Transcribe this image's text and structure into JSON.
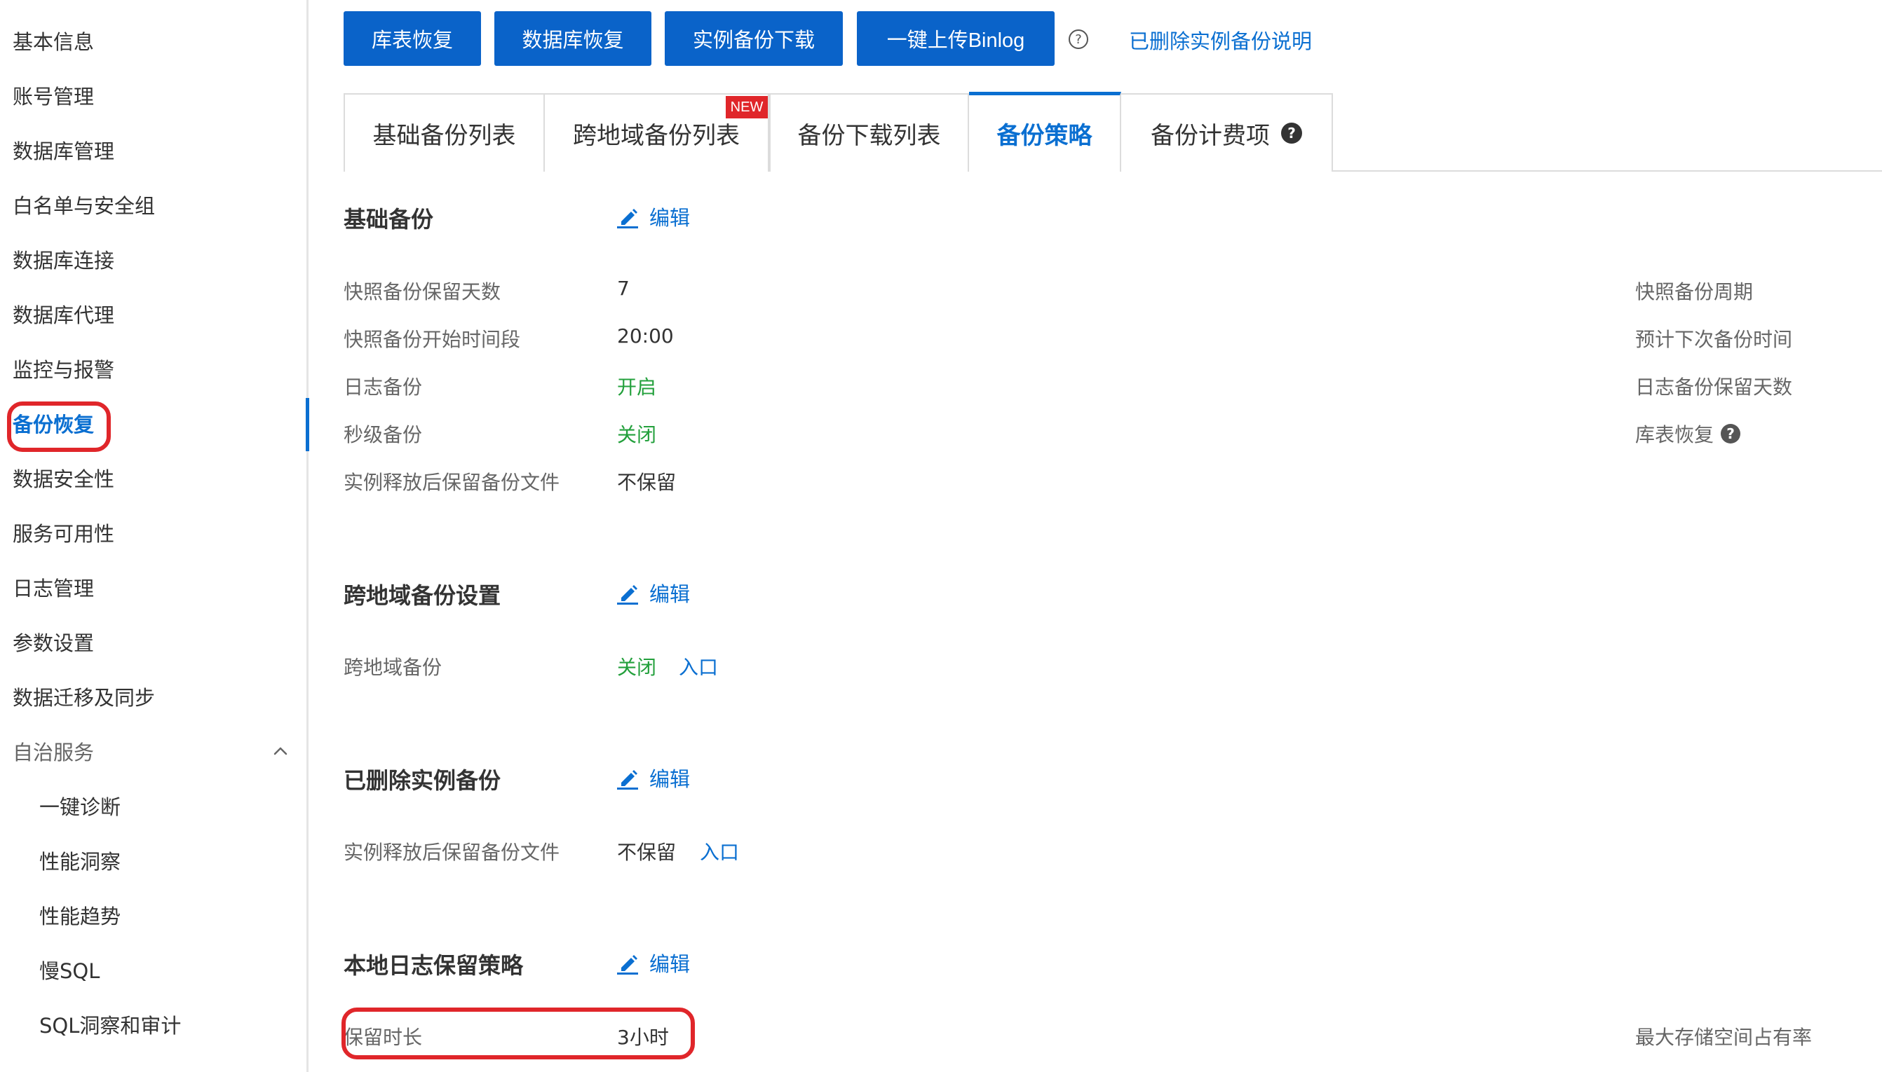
{
  "sidebar": {
    "items": [
      {
        "label": "基本信息"
      },
      {
        "label": "账号管理"
      },
      {
        "label": "数据库管理"
      },
      {
        "label": "白名单与安全组"
      },
      {
        "label": "数据库连接"
      },
      {
        "label": "数据库代理"
      },
      {
        "label": "监控与报警"
      },
      {
        "label": "备份恢复",
        "active": true
      },
      {
        "label": "数据安全性"
      },
      {
        "label": "服务可用性"
      },
      {
        "label": "日志管理"
      },
      {
        "label": "参数设置"
      },
      {
        "label": "数据迁移及同步"
      }
    ],
    "group": {
      "label": "自治服务",
      "expanded": true
    },
    "subitems": [
      {
        "label": "一键诊断"
      },
      {
        "label": "性能洞察"
      },
      {
        "label": "性能趋势"
      },
      {
        "label": "慢SQL"
      },
      {
        "label": "SQL洞察和审计"
      }
    ]
  },
  "toolbar": {
    "buttons": [
      {
        "label": "库表恢复"
      },
      {
        "label": "数据库恢复"
      },
      {
        "label": "实例备份下载"
      },
      {
        "label": "一键上传Binlog"
      }
    ],
    "help_icon": "question-circle-icon",
    "link": "已删除实例备份说明"
  },
  "tabs": {
    "items": [
      {
        "label": "基础备份列表"
      },
      {
        "label": "跨地域备份列表",
        "badge": "NEW"
      },
      {
        "label": "备份下载列表"
      },
      {
        "label": "备份策略",
        "active": true
      },
      {
        "label": "备份计费项",
        "help": true
      }
    ]
  },
  "sections": {
    "basic": {
      "title": "基础备份",
      "edit": "编辑",
      "rows": [
        {
          "label": "快照备份保留天数",
          "value": "7"
        },
        {
          "label": "快照备份开始时间段",
          "value": "20:00"
        },
        {
          "label": "日志备份",
          "value": "开启"
        },
        {
          "label": "秒级备份",
          "value": "关闭"
        },
        {
          "label": "实例释放后保留备份文件",
          "value": "不保留"
        }
      ],
      "right_labels": [
        "快照备份周期",
        "预计下次备份时间",
        "日志备份保留天数",
        "库表恢复"
      ]
    },
    "cross_region": {
      "title": "跨地域备份设置",
      "edit": "编辑",
      "row": {
        "label": "跨地域备份",
        "value": "关闭",
        "link": "入口"
      }
    },
    "deleted": {
      "title": "已删除实例备份",
      "edit": "编辑",
      "row": {
        "label": "实例释放后保留备份文件",
        "value": "不保留",
        "link": "入口"
      }
    },
    "local_log": {
      "title": "本地日志保留策略",
      "edit": "编辑",
      "row": {
        "label": "保留时长",
        "value": "3小时"
      },
      "right_label": "最大存储空间占有率"
    }
  },
  "colors": {
    "primary": "#0a63c9",
    "link": "#0a6fd1",
    "green": "#23a03c",
    "highlight": "#e0262a"
  }
}
